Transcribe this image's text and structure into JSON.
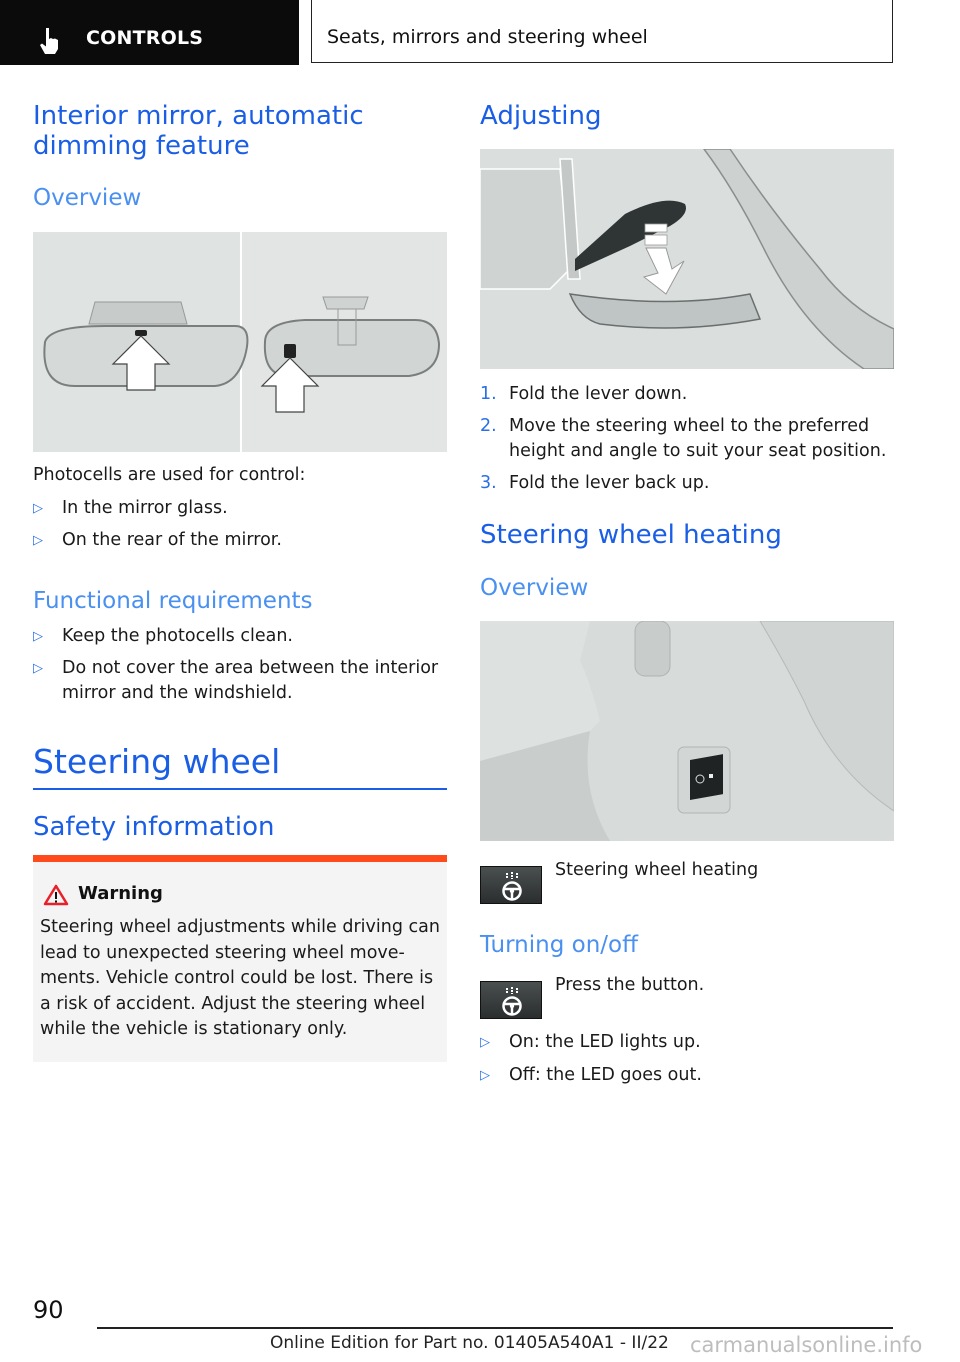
{
  "header": {
    "section_icon": "pointing-hand-icon",
    "section": "CONTROLS",
    "chapter": "Seats, mirrors and steering wheel"
  },
  "left": {
    "mirror_title": "Interior mirror, automatic dimming feature",
    "overview_heading": "Overview",
    "mirror_figure": "interior-mirror-photocells-illustration",
    "photocells_intro": "Photocells are used for control:",
    "photocells_list": [
      "In the mirror glass.",
      "On the rear of the mirror."
    ],
    "functional_heading": "Functional requirements",
    "functional_list": [
      "Keep the photocells clean.",
      "Do not cover the area between the interior mirror and the windshield."
    ],
    "steering_title": "Steering wheel",
    "safety_heading": "Safety information",
    "warning": {
      "icon": "warning-triangle-icon",
      "title": "Warning",
      "body": "Steering wheel adjustments while driving can lead to unexpected steering wheel move-ments. Vehicle control could be lost. There is a risk of accident. Adjust the steering wheel while the vehicle is stationary only."
    }
  },
  "right": {
    "adjusting_heading": "Adjusting",
    "adjusting_figure": "steering-column-lever-illustration",
    "steps": [
      {
        "num": "1.",
        "text": "Fold the lever down."
      },
      {
        "num": "2.",
        "text": "Move the steering wheel to the preferred height and angle to suit your seat position."
      },
      {
        "num": "3.",
        "text": "Fold the lever back up."
      }
    ],
    "heating_heading": "Steering wheel heating",
    "overview_heading": "Overview",
    "heating_figure": "steering-wheel-heating-button-illustration",
    "heating_button_label": "Steering wheel heating",
    "turning_heading": "Turning on/off",
    "press_label": "Press the button.",
    "led_list": [
      "On: the LED lights up.",
      "Off: the LED goes out."
    ]
  },
  "footer": {
    "page_number": "90",
    "edition": "Online Edition for Part no. 01405A540A1 - II/22",
    "watermark": "carmanualsonline.info"
  },
  "colors": {
    "heading_blue": "#1a5ee6",
    "subheading_blue": "#4a90f0",
    "warning_orange": "#ff4a1c",
    "warning_bg": "#f4f4f4"
  }
}
